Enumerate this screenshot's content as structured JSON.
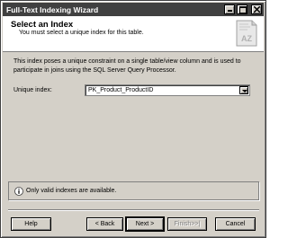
{
  "window": {
    "title": "Full-Text Indexing Wizard"
  },
  "header": {
    "title": "Select an Index",
    "subtitle": "You must select a unique index for this table.",
    "icon": "wizard-az-icon"
  },
  "main": {
    "description": "This index poses a unique constraint on a single table/view column and is used to participate in joins using the SQL Server Query Processor.",
    "unique_index_label": "Unique index:",
    "unique_index_value": "PK_Product_ProductID"
  },
  "status": {
    "icon": "info-icon",
    "message": "Only valid indexes are available."
  },
  "buttons": {
    "help": "Help",
    "back": "< Back",
    "next": "Next >",
    "finish": "Finish>>|",
    "cancel": "Cancel"
  }
}
